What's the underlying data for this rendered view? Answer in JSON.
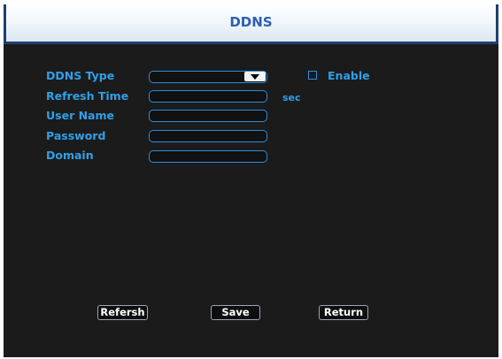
{
  "window": {
    "title": "DDNS"
  },
  "form": {
    "ddns_type": {
      "label": "DDNS Type",
      "value": ""
    },
    "enable": {
      "label": "Enable",
      "checked": false
    },
    "refresh_time": {
      "label": "Refresh Time",
      "value": "",
      "unit": "sec"
    },
    "user_name": {
      "label": "User Name",
      "value": ""
    },
    "password": {
      "label": "Password",
      "value": ""
    },
    "domain": {
      "label": "Domain",
      "value": ""
    }
  },
  "buttons": {
    "refresh": "Refersh",
    "save": "Save",
    "return": "Return"
  },
  "colors": {
    "accent": "#2fa0e8",
    "background": "#1b1b1b",
    "title_text": "#2a5fb8",
    "title_border": "#1f3f70"
  }
}
